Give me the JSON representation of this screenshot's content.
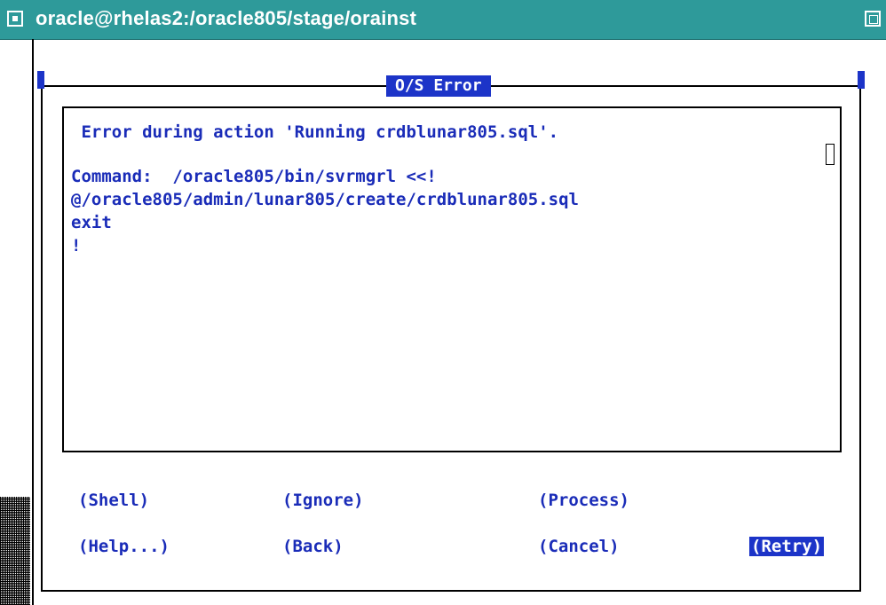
{
  "window": {
    "title": "oracle@rhelas2:/oracle805/stage/orainst"
  },
  "dialog": {
    "title": "O/S Error",
    "message_lines": [
      " Error during action 'Running crdblunar805.sql'.",
      "",
      "Command:  /oracle805/bin/svrmgrl <<!",
      "@/oracle805/admin/lunar805/create/crdblunar805.sql",
      "exit",
      "!"
    ]
  },
  "buttons": {
    "shell": "(Shell)",
    "ignore": "(Ignore)",
    "process": "(Process)",
    "help": "(Help...)",
    "back": "(Back)",
    "cancel": "(Cancel)",
    "retry": "(Retry)"
  },
  "colors": {
    "titlebar": "#2e9a9a",
    "accent": "#1c34c8",
    "text": "#1a2cb8"
  },
  "icons": {
    "window_menu": "window-menu-icon",
    "maximize": "maximize-icon"
  }
}
